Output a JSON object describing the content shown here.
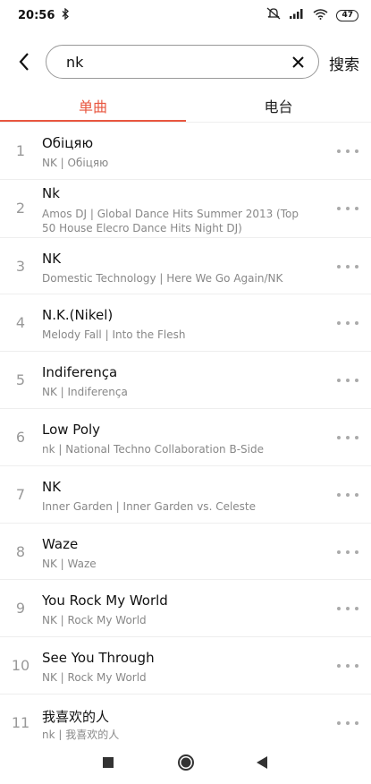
{
  "status_bar": {
    "time": "20:56",
    "bluetooth_icon": "bluetooth-icon",
    "battery": "47"
  },
  "search": {
    "value": "nk",
    "search_button": "搜索"
  },
  "tabs": [
    {
      "label": "单曲",
      "active": true
    },
    {
      "label": "电台",
      "active": false
    }
  ],
  "songs": [
    {
      "index": "1",
      "title": "Обіцяю",
      "subtitle": "NK | Обіцяю"
    },
    {
      "index": "2",
      "title": "Nk",
      "subtitle": "Amos DJ | Global Dance Hits Summer 2013 (Top 50 House Elecro Dance Hits Night DJ)"
    },
    {
      "index": "3",
      "title": "NK",
      "subtitle": "Domestic Technology | Here We Go Again/NK"
    },
    {
      "index": "4",
      "title": "N.K.(Nikel)",
      "subtitle": "Melody Fall | Into the Flesh"
    },
    {
      "index": "5",
      "title": "Indiferença",
      "subtitle": "NK | Indiferença"
    },
    {
      "index": "6",
      "title": "Low Poly",
      "subtitle": "nk | National Techno Collaboration B-Side"
    },
    {
      "index": "7",
      "title": "NK",
      "subtitle": "Inner Garden | Inner Garden vs. Celeste"
    },
    {
      "index": "8",
      "title": "Waze",
      "subtitle": "NK | Waze"
    },
    {
      "index": "9",
      "title": "You Rock My World",
      "subtitle": "NK | Rock My World"
    },
    {
      "index": "10",
      "title": "See You Through",
      "subtitle": "NK | Rock My World"
    },
    {
      "index": "11",
      "title": "我喜欢的人",
      "subtitle": "nk | 我喜欢的人"
    }
  ],
  "colors": {
    "accent": "#e8563f",
    "divider": "#eeeeee",
    "secondary_text": "#888888"
  }
}
